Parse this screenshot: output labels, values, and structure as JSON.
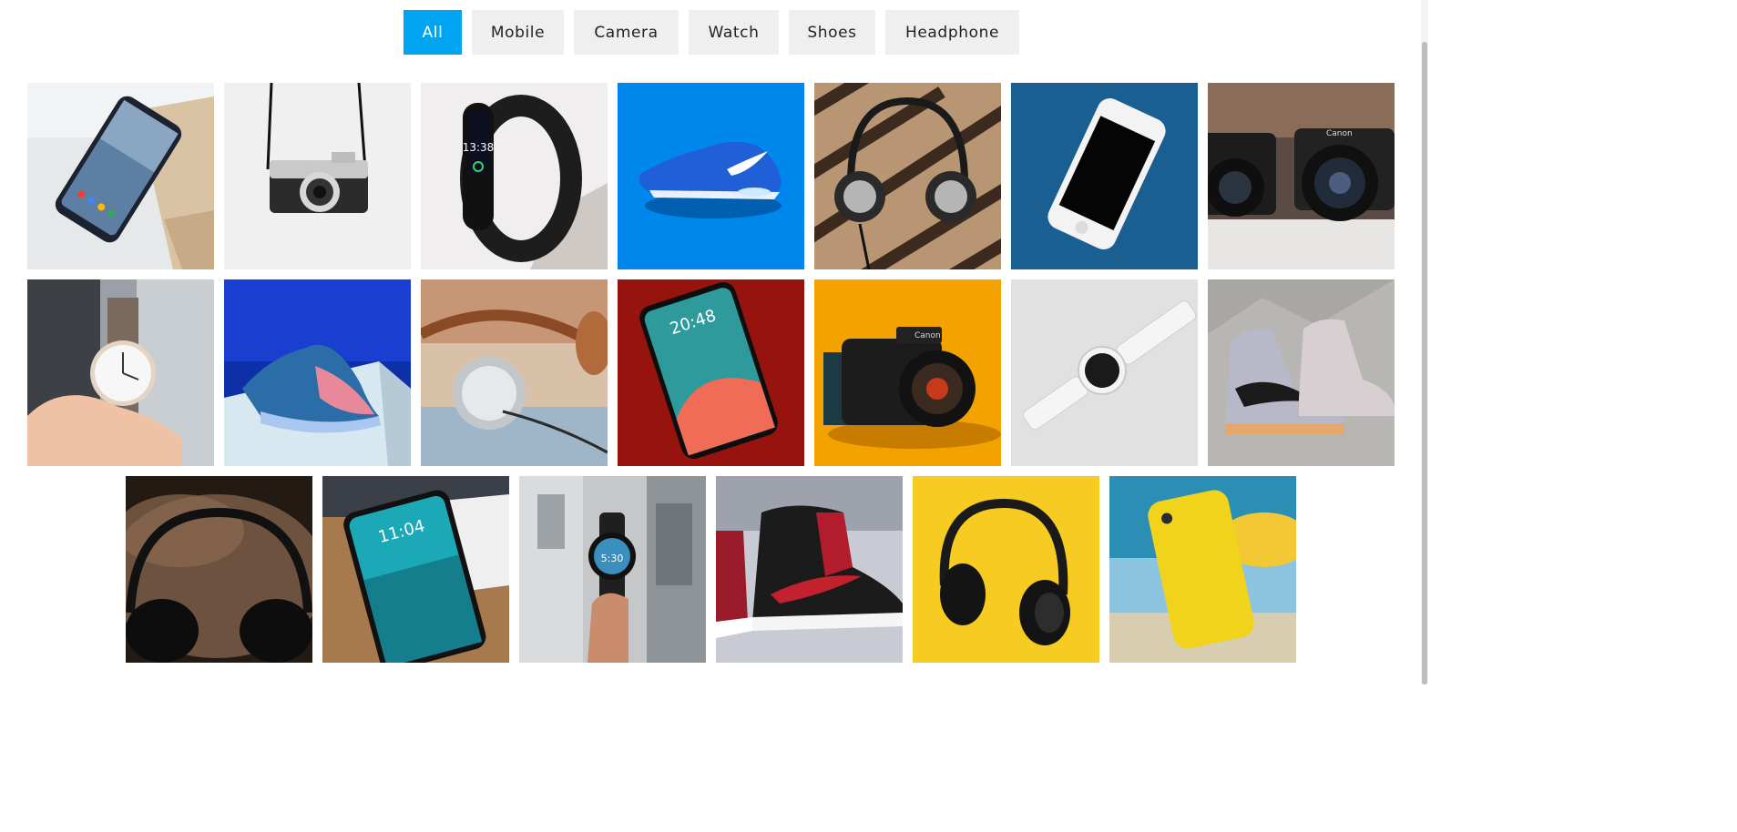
{
  "filters": {
    "items": [
      "All",
      "Mobile",
      "Camera",
      "Watch",
      "Shoes",
      "Headphone"
    ],
    "active": "All"
  },
  "colors": {
    "accent": "#00a4f0",
    "filter_bg": "#efefef"
  },
  "gallery": {
    "items": [
      {
        "category": "Mobile",
        "image": "smartphone on wooden table"
      },
      {
        "category": "Camera",
        "image": "vintage Canon camera with strap"
      },
      {
        "category": "Watch",
        "image": "black fitness band",
        "screen_text": "13:38"
      },
      {
        "category": "Shoes",
        "image": "blue sneaker on blue background"
      },
      {
        "category": "Headphone",
        "image": "headphones on wooden pallet"
      },
      {
        "category": "Mobile",
        "image": "white phone on blue carpet"
      },
      {
        "category": "Camera",
        "image": "two Canon cameras"
      },
      {
        "category": "Watch",
        "image": "analog watch in hand"
      },
      {
        "category": "Shoes",
        "image": "running shoe on blue stand"
      },
      {
        "category": "Headphone",
        "image": "metal headphones closeup"
      },
      {
        "category": "Mobile",
        "image": "phone lock screen on red background",
        "screen_text": "20:48"
      },
      {
        "category": "Camera",
        "image": "Canon camera on orange background"
      },
      {
        "category": "Watch",
        "image": "white smartwatch"
      },
      {
        "category": "Shoes",
        "image": "high-top sneakers on paper"
      },
      {
        "category": "Headphone",
        "image": "headphones on fur"
      },
      {
        "category": "Mobile",
        "image": "phone on box",
        "screen_text": "11:04"
      },
      {
        "category": "Watch",
        "image": "round smartwatch in hand",
        "screen_text": "5:30"
      },
      {
        "category": "Shoes",
        "image": "black and red sneakers"
      },
      {
        "category": "Headphone",
        "image": "black headphones on yellow"
      },
      {
        "category": "Mobile",
        "image": "yellow phone case at beach"
      }
    ]
  }
}
